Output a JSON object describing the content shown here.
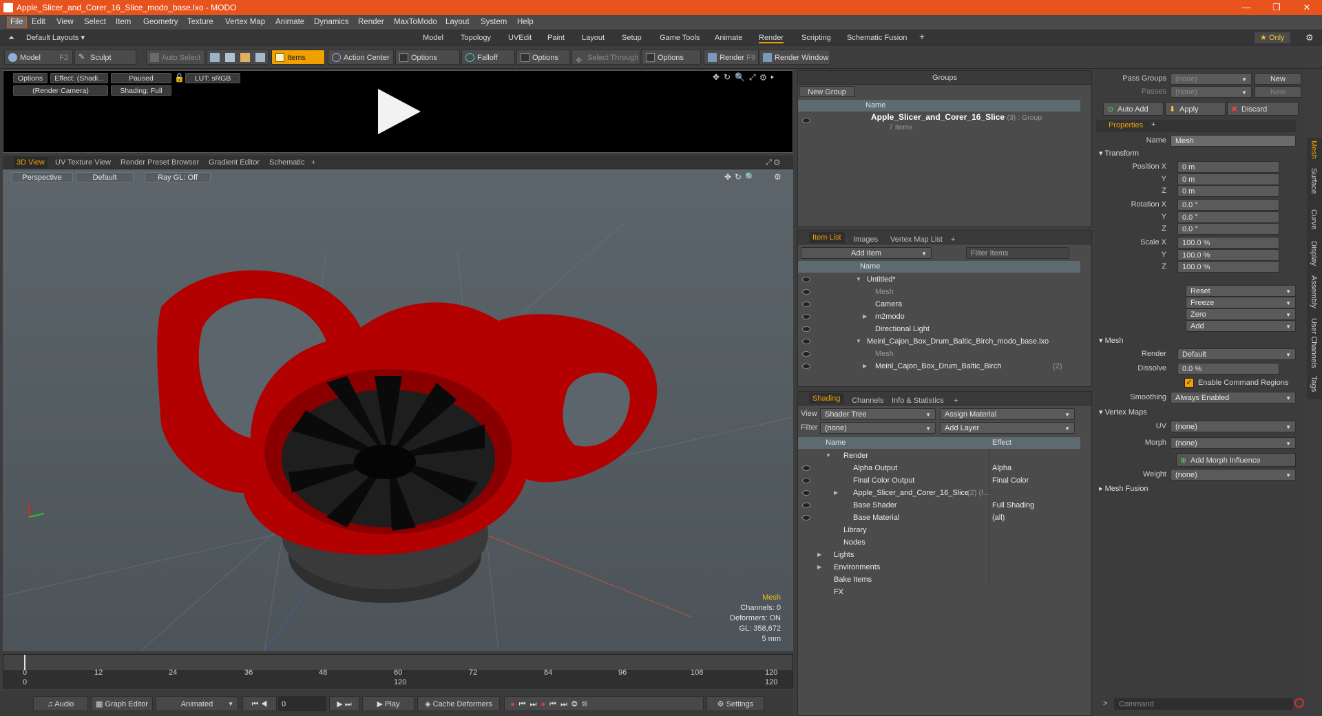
{
  "window": {
    "title": "Apple_Slicer_and_Corer_16_Slice_modo_base.lxo - MODO",
    "min": "—",
    "max": "❐",
    "close": "✕"
  },
  "menu": [
    "File",
    "Edit",
    "View",
    "Select",
    "Item",
    "Geometry",
    "Texture",
    "Vertex Map",
    "Animate",
    "Dynamics",
    "Render",
    "MaxToModo",
    "Layout",
    "System",
    "Help"
  ],
  "layouts": {
    "current": "Default Layouts ▾",
    "tabs": [
      "Model",
      "Topology",
      "UVEdit",
      "Paint",
      "Layout",
      "Setup",
      "Game Tools",
      "Animate",
      "Render",
      "Scripting",
      "Schematic Fusion"
    ],
    "active": "Render",
    "plus": "+",
    "only": "★  Only",
    "gear": "⚙"
  },
  "toolbar": {
    "model": "Model",
    "model_key": "F2",
    "sculpt": "Sculpt",
    "auto_select": "Auto Select",
    "items": "Items",
    "action_center": "Action Center",
    "options1": "Options",
    "falloff": "Falloff",
    "options2": "Options",
    "select_through": "Select Through",
    "options3": "Options",
    "render": "Render",
    "render_key": "F9",
    "render_window": "Render Window"
  },
  "render_preview": {
    "options": "Options",
    "effect": "Effect: (Shadi...",
    "paused": "Paused",
    "lut": "LUT: sRGB",
    "camera": "(Render Camera)",
    "shading": "Shading: Full"
  },
  "viewport_tabs": [
    "3D View",
    "UV Texture View",
    "Render Preset Browser",
    "Gradient Editor",
    "Schematic",
    "+"
  ],
  "viewport": {
    "projection": "Perspective",
    "style": "Default",
    "raygl": "Ray GL: Off",
    "info": [
      "Mesh",
      "Channels: 0",
      "Deformers: ON",
      "GL: 358,672",
      "5 mm"
    ]
  },
  "timeline": {
    "ticks": [
      "0",
      "12",
      "24",
      "36",
      "48",
      "60",
      "72",
      "84",
      "96",
      "108",
      "120"
    ],
    "ticks2": [
      "0",
      "120",
      "120"
    ]
  },
  "bottom": {
    "audio": "Audio",
    "graph": "Graph Editor",
    "animated": "Animated",
    "frame": "0",
    "play": "Play",
    "cache": "Cache Deformers",
    "settings": "Settings"
  },
  "groups": {
    "title": "Groups",
    "new_group": "New Group",
    "col_name": "Name",
    "item": "Apple_Slicer_and_Corer_16_Slice",
    "item_suffix": "(3) : Group",
    "sub": "7 Items"
  },
  "itemlist": {
    "tabs": [
      "Item List",
      "Images",
      "Vertex Map List",
      "+"
    ],
    "add_item": "Add Item",
    "filter": "Filter Items",
    "col_name": "Name",
    "rows": [
      {
        "label": "Untitled*",
        "indent": 0,
        "arrow": "▼"
      },
      {
        "label": "Mesh",
        "indent": 1,
        "arrow": "",
        "dim": true
      },
      {
        "label": "Camera",
        "indent": 1,
        "arrow": ""
      },
      {
        "label": "m2modo",
        "indent": 1,
        "arrow": "▶"
      },
      {
        "label": "Directional Light",
        "indent": 1,
        "arrow": ""
      },
      {
        "label": "Meinl_Cajon_Box_Drum_Baltic_Birch_modo_base.lxo",
        "indent": 0,
        "arrow": "▼"
      },
      {
        "label": "Mesh",
        "indent": 1,
        "arrow": "",
        "dim": true
      },
      {
        "label": "Meinl_Cajon_Box_Drum_Baltic_Birch",
        "indent": 1,
        "arrow": "▶",
        "suffix": "(2)"
      }
    ]
  },
  "shading": {
    "tabs": [
      "Shading",
      "Channels",
      "Info & Statistics",
      "+"
    ],
    "view_label": "View",
    "view": "Shader Tree",
    "assign": "Assign Material",
    "filter_label": "Filter",
    "filter": "(none)",
    "add_layer": "Add Layer",
    "col_name": "Name",
    "col_effect": "Effect",
    "rows": [
      {
        "name": "Render",
        "effect": "",
        "indent": 0,
        "arrow": "▼"
      },
      {
        "name": "Alpha Output",
        "effect": "Alpha",
        "indent": 1
      },
      {
        "name": "Final Color Output",
        "effect": "Final Color",
        "indent": 1
      },
      {
        "name": "Apple_Slicer_and_Corer_16_Slice",
        "suffix": "(2) (I...",
        "effect": "",
        "indent": 1,
        "arrow": "▶"
      },
      {
        "name": "Base Shader",
        "effect": "Full Shading",
        "indent": 1
      },
      {
        "name": "Base Material",
        "effect": "(all)",
        "indent": 1
      },
      {
        "name": "Library",
        "effect": "",
        "indent": 0,
        "arrow": ""
      },
      {
        "name": "Nodes",
        "effect": "",
        "indent": 0,
        "arrow": ""
      },
      {
        "name": "Lights",
        "effect": "",
        "indent": -1,
        "arrow": "▶"
      },
      {
        "name": "Environments",
        "effect": "",
        "indent": -1,
        "arrow": "▶"
      },
      {
        "name": "Bake Items",
        "effect": "",
        "indent": -1
      },
      {
        "name": "FX",
        "effect": "",
        "indent": -1
      }
    ]
  },
  "passes": {
    "pass_groups": "Pass Groups",
    "passes": "Passes",
    "none": "(none)",
    "new": "New",
    "auto_add": "Auto Add",
    "apply": "Apply",
    "discard": "Discard"
  },
  "properties": {
    "tab": "Properties",
    "plus": "+",
    "name_label": "Name",
    "name": "Mesh",
    "transform": "Transform",
    "pos_label": "Position X",
    "rot_label": "Rotation X",
    "scale_label": "Scale X",
    "y": "Y",
    "z": "Z",
    "pos": [
      "0 m",
      "0 m",
      "0 m"
    ],
    "rot": [
      "0.0 °",
      "0.0 °",
      "0.0 °"
    ],
    "scale": [
      "100.0 %",
      "100.0 %",
      "100.0 %"
    ],
    "reset": "Reset",
    "freeze": "Freeze",
    "zero": "Zero",
    "add": "Add",
    "mesh": "Mesh",
    "render_label": "Render",
    "render": "Default",
    "dissolve_label": "Dissolve",
    "dissolve": "0.0 %",
    "cmd_regions": "Enable Command Regions",
    "smoothing_label": "Smoothing",
    "smoothing": "Always Enabled",
    "vertex_maps": "Vertex Maps",
    "uv_label": "UV",
    "uv": "(none)",
    "morph_label": "Morph",
    "morph": "(none)",
    "add_morph": "Add Morph Influence",
    "weight_label": "Weight",
    "weight": "(none)",
    "mesh_fusion": "Mesh Fusion"
  },
  "side_tabs": [
    "Mesh",
    "Surface",
    "Curve",
    "Display",
    "Assembly",
    "User Channels",
    "Tags"
  ],
  "command": {
    "placeholder": "Command"
  }
}
